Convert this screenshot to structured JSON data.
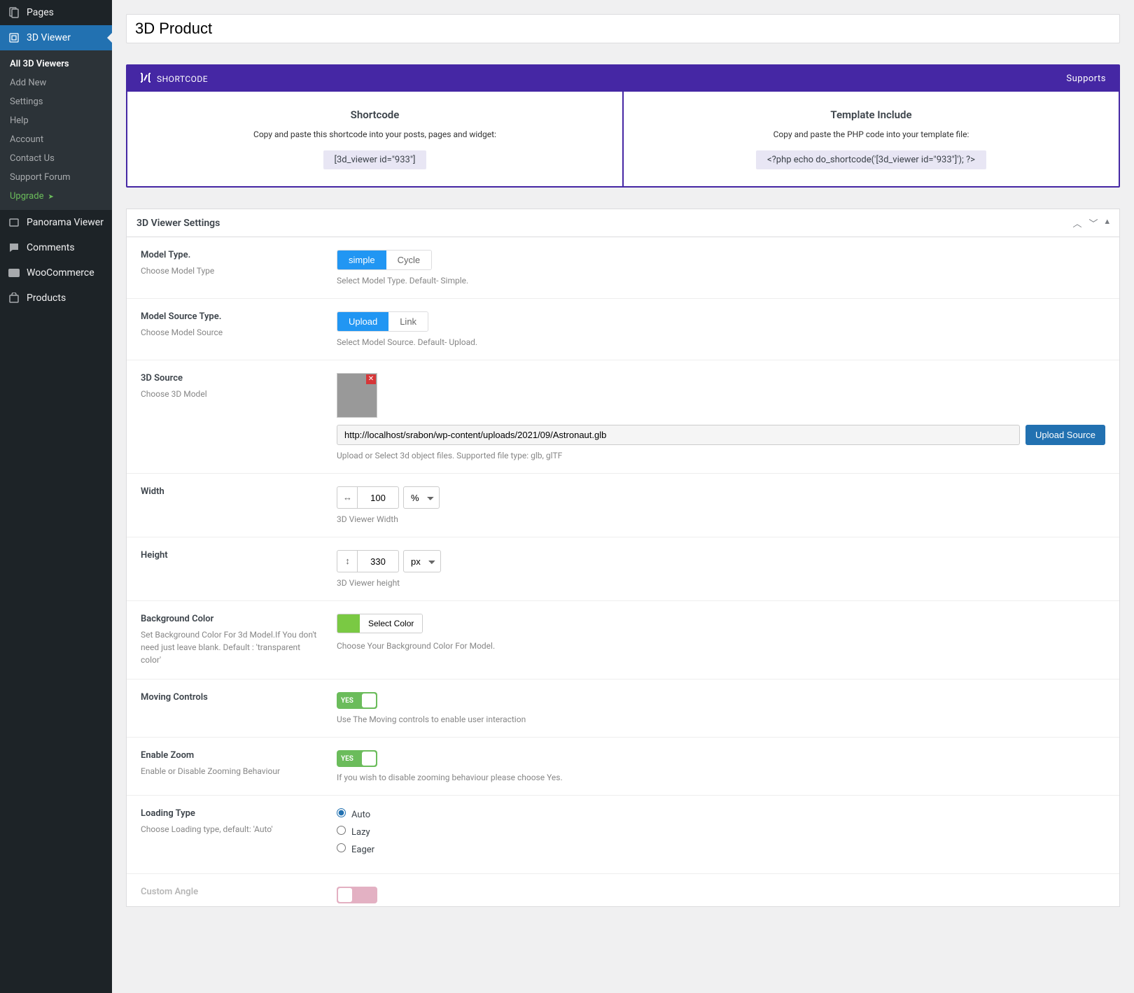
{
  "sidebar": {
    "top_items": [
      {
        "icon": "📄",
        "label": "Pages"
      }
    ],
    "active": {
      "icon": "🧊",
      "label": "3D Viewer"
    },
    "submenu": [
      {
        "label": "All 3D Viewers",
        "current": true
      },
      {
        "label": "Add New"
      },
      {
        "label": "Settings"
      },
      {
        "label": "Help"
      },
      {
        "label": "Account"
      },
      {
        "label": "Contact Us"
      },
      {
        "label": "Support Forum"
      },
      {
        "label": "Upgrade",
        "upgrade": true
      }
    ],
    "bottom_items": [
      {
        "icon": "🖼",
        "label": "Panorama Viewer"
      },
      {
        "icon": "💬",
        "label": "Comments"
      },
      {
        "icon": "🛒",
        "label": "WooCommerce"
      },
      {
        "icon": "📦",
        "label": "Products"
      }
    ]
  },
  "title": "3D Product",
  "shortcode": {
    "header": "SHORTCODE",
    "supports": "Supports",
    "col1": {
      "title": "Shortcode",
      "desc": "Copy and paste this shortcode into your posts, pages and widget:",
      "code": "[3d_viewer id=\"933\"]"
    },
    "col2": {
      "title": "Template Include",
      "desc": "Copy and paste the PHP code into your template file:",
      "code": "<?php echo do_shortcode('[3d_viewer id=\"933\"]'); ?>"
    }
  },
  "panel": {
    "title": "3D Viewer Settings",
    "model_type": {
      "label": "Model Type.",
      "desc": "Choose Model Type",
      "opts": [
        "simple",
        "Cycle"
      ],
      "active": 0,
      "help": "Select Model Type. Default- Simple."
    },
    "model_source_type": {
      "label": "Model Source Type.",
      "desc": "Choose Model Source",
      "opts": [
        "Upload",
        "Link"
      ],
      "active": 0,
      "help": "Select Model Source. Default- Upload."
    },
    "source": {
      "label": "3D Source",
      "desc": "Choose 3D Model",
      "value": "http://localhost/srabon/wp-content/uploads/2021/09/Astronaut.glb",
      "btn": "Upload Source",
      "help": "Upload or Select 3d object files. Supported file type: glb, glTF"
    },
    "width": {
      "label": "Width",
      "value": "100",
      "unit": "%",
      "help": "3D Viewer Width"
    },
    "height": {
      "label": "Height",
      "value": "330",
      "unit": "px",
      "help": "3D Viewer height"
    },
    "bgcolor": {
      "label": "Background Color",
      "desc": "Set Background Color For 3d Model.If You don't need just leave blank. Default : 'transparent color'",
      "btn": "Select Color",
      "help": "Choose Your Background Color For Model.",
      "value": "#7ac943"
    },
    "moving": {
      "label": "Moving Controls",
      "state": "YES",
      "on": true,
      "help": "Use The Moving controls to enable user interaction"
    },
    "zoom": {
      "label": "Enable Zoom",
      "desc": "Enable or Disable Zooming Behaviour",
      "state": "YES",
      "on": true,
      "help": "If you wish to disable zooming behaviour please choose Yes."
    },
    "loading": {
      "label": "Loading Type",
      "desc": "Choose Loading type, default: 'Auto'",
      "opts": [
        "Auto",
        "Lazy",
        "Eager"
      ],
      "checked": 0
    },
    "custom_angle": {
      "label": "Custom Angle",
      "state": "NO",
      "on": false
    }
  }
}
